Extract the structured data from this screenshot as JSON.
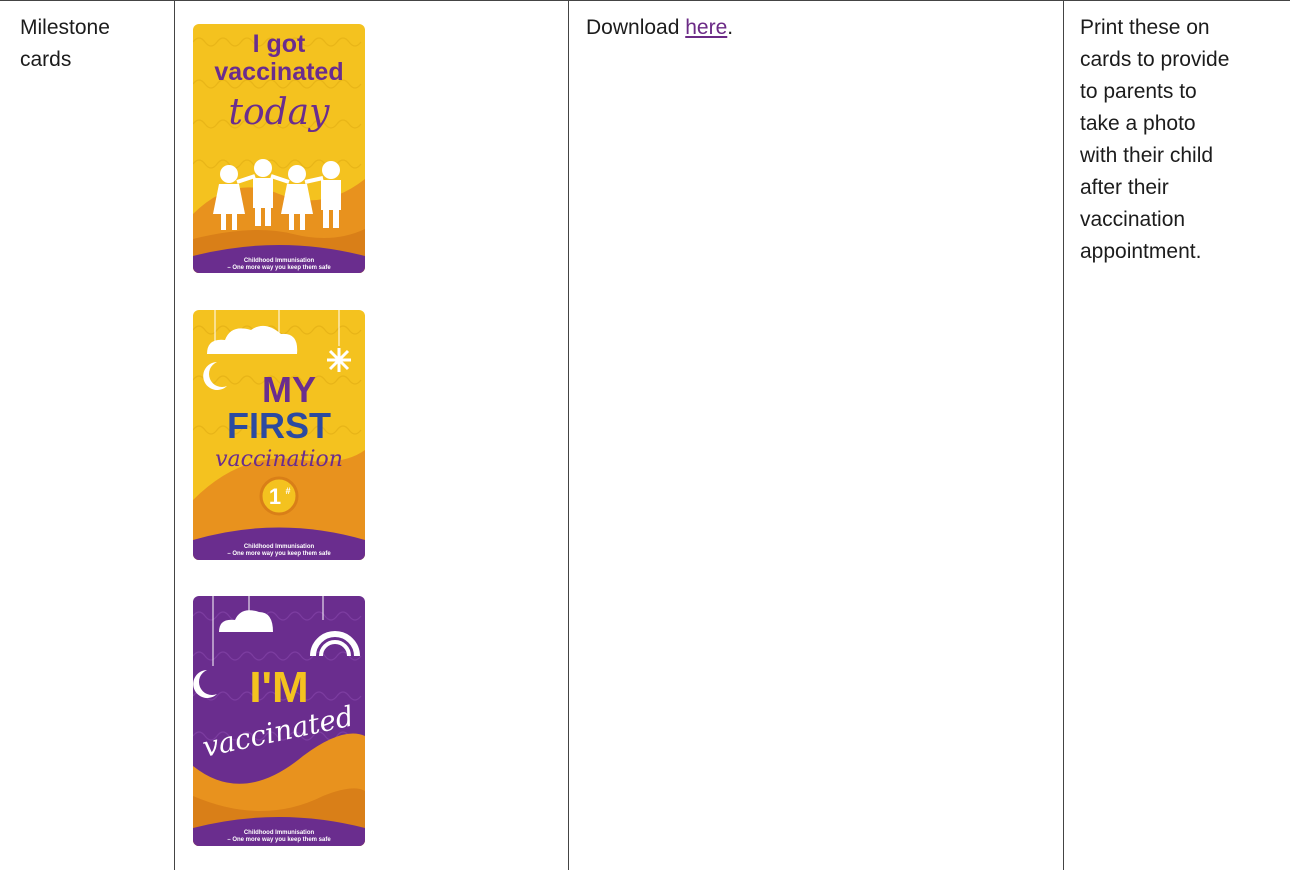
{
  "row": {
    "label_line1": "Milestone",
    "label_line2": "cards",
    "download_prefix": "Download ",
    "download_link": "here",
    "download_suffix": ".",
    "notes_lines": [
      "Print these on",
      "cards to provide",
      "to parents to",
      "take a photo",
      "with their child",
      "after their",
      "vaccination",
      "appointment."
    ]
  },
  "cards": [
    {
      "name": "i-got-vaccinated-today",
      "line1": "I got",
      "line2": "vaccinated",
      "script": "today",
      "footer1": "Childhood Immunisation",
      "footer2": "– One more way you keep them safe"
    },
    {
      "name": "my-first-vaccination",
      "line1": "MY",
      "line2": "FIRST",
      "script": "vaccination",
      "badge": "1",
      "badge_sup": "#",
      "footer1": "Childhood Immunisation",
      "footer2": "– One more way you keep them safe"
    },
    {
      "name": "im-vaccinated",
      "line1": "I'M",
      "script": "vaccinated",
      "footer1": "Childhood Immunisation",
      "footer2": "– One more way you keep them safe"
    }
  ],
  "colors": {
    "yellow": "#f4c21f",
    "orange": "#e8921e",
    "purple": "#6a2d8e",
    "link": "#6b2a86"
  }
}
